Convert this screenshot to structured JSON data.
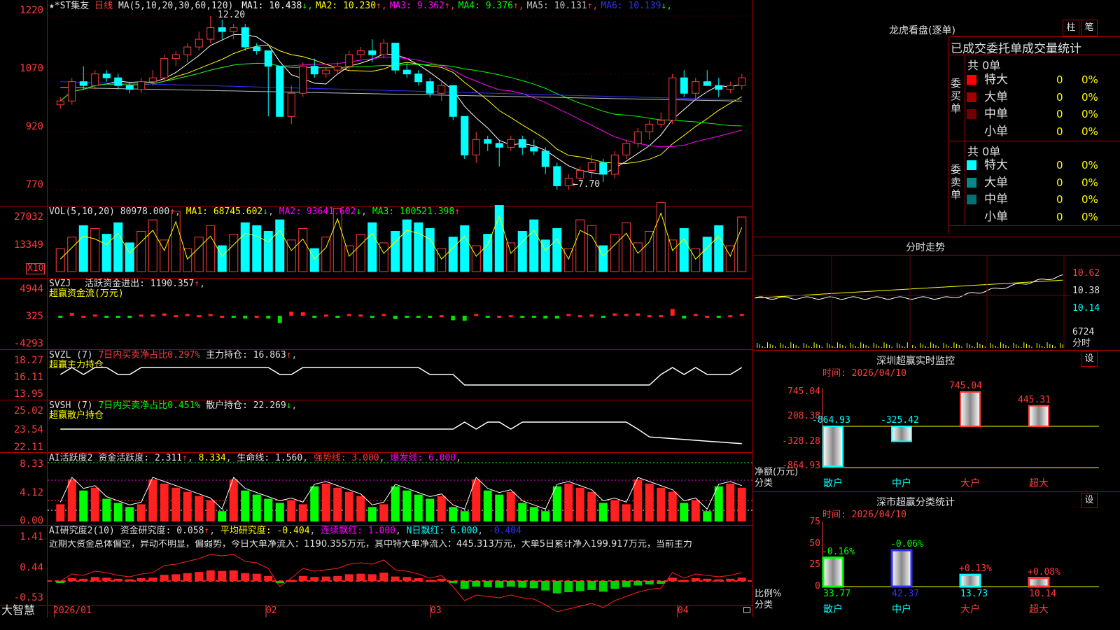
{
  "stock": {
    "name": "★*ST集友",
    "period": "日线",
    "params": "MA(5,10,20,30,60,120)"
  },
  "ma_line": [
    {
      "label": "MA1: 10.438",
      "arrow": "↓",
      "color": "#ffffff"
    },
    {
      "label": "MA2: 10.230",
      "arrow": "↑",
      "color": "#ffff00"
    },
    {
      "label": "MA3: 9.362",
      "arrow": "↑",
      "color": "#ff00ff"
    },
    {
      "label": "MA4: 9.376",
      "arrow": "↑",
      "color": "#00ff00"
    },
    {
      "label": "MA5: 10.131",
      "arrow": "↑",
      "color": "#c0c0c0"
    },
    {
      "label": "MA6: 10.139",
      "arrow": "↓",
      "color": "#3030ff"
    }
  ],
  "main_axis": [
    "1220",
    "1070",
    "920",
    "770"
  ],
  "annotations": {
    "high": "12.20",
    "low": "←7.70"
  },
  "vol": {
    "title": "VOL(5,10,20)",
    "value": "80978.000",
    "ma1": "MA1: 68745.602",
    "ma2": "MA2: 93641.602",
    "ma3": "MA3: 100521.398",
    "axis": [
      "27032",
      "13349"
    ],
    "unit": "X10"
  },
  "svzj": {
    "title": "SVZJ",
    "label": "活跃资金进出: 1190.357",
    "sub": "超赢资金流(万元)",
    "axis": [
      "4944",
      "325",
      "-4293"
    ]
  },
  "svzl": {
    "title": "SVZL (7)",
    "label1": "7日内买卖净占比0.297%",
    "label2": "主力持仓: 16.863",
    "sub": "超赢主力持仓",
    "axis": [
      "18.27",
      "16.11",
      "13.95"
    ]
  },
  "svsh": {
    "title": "SVSH (7)",
    "label1": "7日内买卖净占比0.451%",
    "label2": "散户持仓: 22.269",
    "sub": "超赢散户持仓",
    "axis": [
      "25.02",
      "23.54",
      "22.11"
    ]
  },
  "ai1": {
    "title": "AI活跃度2",
    "label1": "资金活跃度: 2.311",
    "label2": "8.334",
    "label3": "生命线: 1.560",
    "label4": "强势线: 3.000",
    "label5": "爆发线: 6.000",
    "axis": [
      "8.33",
      "4.12",
      "0.00"
    ]
  },
  "ai2": {
    "title": "AI研究度2(10)",
    "label1": "资金研究度: 0.058",
    "label2": "平均研究度: -0.404",
    "label3": "连续飘红: 1.000",
    "label4": "N日飘红: 6.000",
    "label5": "-0.404",
    "axis": [
      "1.41",
      "0.44",
      "-0.53"
    ],
    "text": "近期大资金总体偏空，异动不明显，偏弱势，今日大单净流入：1190.355万元，其中特大单净流入：445.313万元，大单5日累计净入199.917万元，当前主力"
  },
  "xaxis": {
    "brand": "大智慧",
    "labels": [
      "2026/01",
      "02",
      "03",
      "04"
    ]
  },
  "right": {
    "lhb_title": "龙虎看盘(逐单)",
    "btn1": "柱",
    "btn2": "笔",
    "stat_title": "已成交委托单成交量统计",
    "buy_side": "委买单",
    "sell_side": "委卖单",
    "total_buy": "共 0单",
    "total_sell": "共 0单",
    "buy_rows": [
      {
        "name": "特大",
        "val": "0",
        "pct": "0%",
        "color": "#ff0000"
      },
      {
        "name": "大单",
        "val": "0",
        "pct": "0%",
        "color": "#a00000"
      },
      {
        "name": "中单",
        "val": "0",
        "pct": "0%",
        "color": "#700000"
      },
      {
        "name": "小单",
        "val": "0",
        "pct": "0%",
        "color": "#000000"
      }
    ],
    "sell_rows": [
      {
        "name": "特大",
        "val": "0",
        "pct": "0%",
        "color": "#00ffff"
      },
      {
        "name": "大单",
        "val": "0",
        "pct": "0%",
        "color": "#008b8b"
      },
      {
        "name": "中单",
        "val": "0",
        "pct": "0%",
        "color": "#007070"
      },
      {
        "name": "小单",
        "val": "0",
        "pct": "0%",
        "color": "#000000"
      }
    ],
    "fs_title": "分时走势",
    "fs_axis": [
      "10.62",
      "10.38",
      "10.14"
    ],
    "fs_vol": "6724",
    "fs_label": "分时",
    "sz_title": "深圳超赢实时监控",
    "sz_btn": "设",
    "sz_time": "时间: 2026/04/10",
    "sz_axis": [
      "745.04",
      "208.38",
      "-328.28",
      "-864.93"
    ],
    "sz_ylabel1": "净额(万元)",
    "sz_ylabel2": "分类",
    "sz_bars": [
      {
        "cat": "散户",
        "val": -864.93,
        "label": "-864.93"
      },
      {
        "cat": "中户",
        "val": -325.42,
        "label": "-325.42"
      },
      {
        "cat": "大户",
        "val": 745.04,
        "label": "745.04"
      },
      {
        "cat": "超大",
        "val": 445.31,
        "label": "445.31"
      }
    ],
    "sc_title": "深市超赢分类统计",
    "sc_btn": "设",
    "sc_time": "时间: 2026/04/10",
    "sc_axis": [
      "75",
      "50",
      "25",
      "0"
    ],
    "sc_ylabel1": "比例%",
    "sc_ylabel2": "分类",
    "sc_bars": [
      {
        "cat": "散户",
        "val": 33.77,
        "chg": "-0.16%",
        "label": "33.77"
      },
      {
        "cat": "中户",
        "val": 42.37,
        "chg": "-0.06%",
        "label": "42.37"
      },
      {
        "cat": "大户",
        "val": 13.73,
        "chg": "+0.13%",
        "label": "13.73"
      },
      {
        "cat": "超大",
        "val": 10.14,
        "chg": "+0.08%",
        "label": "10.14"
      }
    ]
  },
  "chart_data": {
    "type": "candlestick",
    "x": [
      "2026/01",
      "02",
      "03",
      "04"
    ],
    "ohlc": [
      [
        9.9,
        10.1,
        9.8,
        10.0
      ],
      [
        10.0,
        10.6,
        9.9,
        10.5
      ],
      [
        10.5,
        10.9,
        10.3,
        10.4
      ],
      [
        10.4,
        10.8,
        10.3,
        10.7
      ],
      [
        10.7,
        10.8,
        10.5,
        10.6
      ],
      [
        10.6,
        10.7,
        10.3,
        10.4
      ],
      [
        10.4,
        10.5,
        10.2,
        10.3
      ],
      [
        10.3,
        10.6,
        10.2,
        10.5
      ],
      [
        10.5,
        10.8,
        10.4,
        10.6
      ],
      [
        10.6,
        11.2,
        10.5,
        11.1
      ],
      [
        11.1,
        11.3,
        10.9,
        11.2
      ],
      [
        11.2,
        11.5,
        11.0,
        11.4
      ],
      [
        11.4,
        11.8,
        11.3,
        11.6
      ],
      [
        11.6,
        12.2,
        11.5,
        11.9
      ],
      [
        11.9,
        12.1,
        11.6,
        11.8
      ],
      [
        11.8,
        12.0,
        11.6,
        11.9
      ],
      [
        11.9,
        12.0,
        11.3,
        11.4
      ],
      [
        11.4,
        11.5,
        11.2,
        11.3
      ],
      [
        11.3,
        11.3,
        9.6,
        10.9
      ],
      [
        10.9,
        10.9,
        9.6,
        9.6
      ],
      [
        9.6,
        10.4,
        9.4,
        10.2
      ],
      [
        10.2,
        11.0,
        10.1,
        10.9
      ],
      [
        10.9,
        11.1,
        10.6,
        10.7
      ],
      [
        10.7,
        10.9,
        10.6,
        10.8
      ],
      [
        10.8,
        11.0,
        10.7,
        10.9
      ],
      [
        10.9,
        11.3,
        10.8,
        11.2
      ],
      [
        11.2,
        11.4,
        11.1,
        11.3
      ],
      [
        11.3,
        11.6,
        11.0,
        11.2
      ],
      [
        11.2,
        11.6,
        11.1,
        11.5
      ],
      [
        11.5,
        11.5,
        10.7,
        10.8
      ],
      [
        10.8,
        11.0,
        10.6,
        10.7
      ],
      [
        10.7,
        10.8,
        10.4,
        10.5
      ],
      [
        10.5,
        10.6,
        10.1,
        10.2
      ],
      [
        10.2,
        10.5,
        10.0,
        10.4
      ],
      [
        10.4,
        10.4,
        9.5,
        9.6
      ],
      [
        9.6,
        9.6,
        8.5,
        8.6
      ],
      [
        8.6,
        9.2,
        8.4,
        9.0
      ],
      [
        9.0,
        9.1,
        8.7,
        8.9
      ],
      [
        8.9,
        9.0,
        8.3,
        8.8
      ],
      [
        8.8,
        9.1,
        8.7,
        9.0
      ],
      [
        9.0,
        9.1,
        8.6,
        8.8
      ],
      [
        8.8,
        9.0,
        8.6,
        8.7
      ],
      [
        8.7,
        8.8,
        8.1,
        8.3
      ],
      [
        8.3,
        8.4,
        7.7,
        7.8
      ],
      [
        7.8,
        8.1,
        7.7,
        8.0
      ],
      [
        8.0,
        8.3,
        7.9,
        8.2
      ],
      [
        8.2,
        8.6,
        8.0,
        8.4
      ],
      [
        8.4,
        8.5,
        7.9,
        8.1
      ],
      [
        8.1,
        8.7,
        8.0,
        8.6
      ],
      [
        8.6,
        9.0,
        8.5,
        8.9
      ],
      [
        8.9,
        9.3,
        8.8,
        9.2
      ],
      [
        9.2,
        9.5,
        9.0,
        9.4
      ],
      [
        9.4,
        9.7,
        9.3,
        9.5
      ],
      [
        9.5,
        10.7,
        9.4,
        10.6
      ],
      [
        10.6,
        10.8,
        10.1,
        10.2
      ],
      [
        10.2,
        10.6,
        10.0,
        10.5
      ],
      [
        10.5,
        10.8,
        10.4,
        10.4
      ],
      [
        10.4,
        10.6,
        10.1,
        10.3
      ],
      [
        10.3,
        10.5,
        10.2,
        10.4
      ],
      [
        10.4,
        10.7,
        10.3,
        10.6
      ]
    ],
    "ylim": [
      7.5,
      12.4
    ]
  }
}
